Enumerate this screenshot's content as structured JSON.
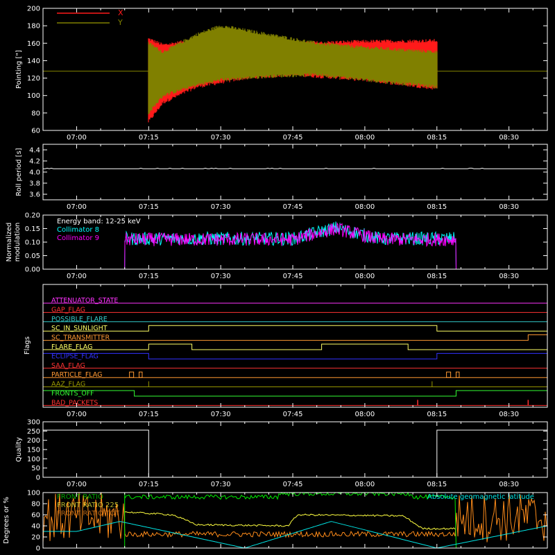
{
  "colors": {
    "background": "#000000",
    "axis": "#ffffff",
    "pointing_x": "#ff1a1a",
    "pointing_y": "#808000",
    "collimator_8": "#00ffff",
    "collimator_9": "#ff00ff",
    "green": "#00ee00",
    "yellow": "#ffff40",
    "orange": "#ff8c1a",
    "cyan": "#00e5e5"
  },
  "time_ticks": [
    "07:00",
    "07:15",
    "07:30",
    "07:45",
    "08:00",
    "08:15",
    "08:30"
  ],
  "chart_data": [
    {
      "type": "line",
      "panel": "pointing",
      "ylabel": "Pointing [\"]",
      "ylim": [
        60,
        200
      ],
      "yticks": [
        "60",
        "80",
        "100",
        "120",
        "140",
        "160",
        "180",
        "200"
      ],
      "legend": [
        "X",
        "Y"
      ],
      "legend_placement": "top-left",
      "baseline": 128,
      "data_window": [
        "07:15",
        "08:15"
      ],
      "series": [
        {
          "name": "X",
          "envelope_times": [
            "07:15",
            "07:18",
            "07:25",
            "07:35",
            "07:45",
            "08:00",
            "08:15"
          ],
          "upper": [
            165,
            158,
            164,
            163,
            160,
            162,
            163
          ],
          "lower": [
            70,
            92,
            110,
            120,
            124,
            118,
            108
          ]
        },
        {
          "name": "Y",
          "envelope_times": [
            "07:15",
            "07:18",
            "07:25",
            "07:30",
            "07:40",
            "07:50",
            "08:00",
            "08:15"
          ],
          "upper": [
            160,
            150,
            170,
            180,
            170,
            160,
            155,
            150
          ],
          "lower": [
            80,
            100,
            112,
            118,
            122,
            124,
            118,
            110
          ]
        }
      ]
    },
    {
      "type": "line",
      "panel": "roll",
      "ylabel": "Roll period [s]",
      "ylim": [
        3.5,
        4.5
      ],
      "yticks": [
        "3.6",
        "3.8",
        "4.0",
        "4.2",
        "4.4"
      ],
      "series": [
        {
          "values": [
            4.06,
            4.06,
            4.06,
            4.06,
            4.06,
            4.06,
            4.06
          ]
        }
      ]
    },
    {
      "type": "line",
      "panel": "modulation",
      "ylabel": "Normalized modulation",
      "ylim": [
        0,
        0.2
      ],
      "yticks": [
        "0.00",
        "0.05",
        "0.10",
        "0.15",
        "0.20"
      ],
      "annotation": "Energy band: 12-25 keV",
      "legend": [
        "Collimator 8",
        "Collimator 9"
      ],
      "start_time": "07:10",
      "end_time": "08:19",
      "mean": 0.11,
      "bump": {
        "from": "07:50",
        "to": "07:58",
        "peak": 0.15
      }
    },
    {
      "type": "line",
      "panel": "flags",
      "ylabel": "Flags",
      "flags": [
        {
          "label": "ATTENUATOR_STATE",
          "color": "#ff33ff",
          "changes": []
        },
        {
          "label": "GAP_FLAG",
          "color": "#ff3333",
          "changes": []
        },
        {
          "label": "POSSIBLE_FLARE",
          "color": "#33cccc",
          "changes": []
        },
        {
          "label": "SC_IN_SUNLIGHT",
          "color": "#ffff66",
          "changes": [
            [
              "07:15",
              1
            ],
            [
              "08:15",
              0
            ]
          ]
        },
        {
          "label": "SC_TRANSMITTER",
          "color": "#ff9933",
          "changes": [
            [
              "08:34",
              1
            ]
          ]
        },
        {
          "label": "FLARE_FLAG",
          "color": "#ffff66",
          "changes": [
            [
              "07:15",
              1
            ],
            [
              "07:24",
              0
            ],
            [
              "07:51",
              1
            ],
            [
              "08:09",
              0
            ]
          ]
        },
        {
          "label": "ECLIPSE_FLAG",
          "color": "#3333ff",
          "initial": 1,
          "changes": [
            [
              "07:15",
              0
            ],
            [
              "08:15",
              1
            ]
          ]
        },
        {
          "label": "SAA_FLAG",
          "color": "#ff3333",
          "changes": []
        },
        {
          "label": "PARTICLE_FLAG",
          "color": "#ff9933",
          "changes": []
        },
        {
          "label": "AAZ_FLAG",
          "color": "#999900",
          "changes": []
        },
        {
          "label": "FRONTS_OFF",
          "color": "#33ff33",
          "initial": 1,
          "changes": [
            [
              "07:12",
              0
            ],
            [
              "08:19",
              1
            ]
          ]
        },
        {
          "label": "BAD_PACKETS",
          "color": "#ff3333",
          "changes": []
        }
      ]
    },
    {
      "type": "line",
      "panel": "quality",
      "ylabel": "Quality",
      "ylim": [
        0,
        300
      ],
      "yticks": [
        "0",
        "50",
        "100",
        "150",
        "200",
        "250",
        "300"
      ],
      "segments": [
        {
          "from": "07:00",
          "to": "07:15",
          "value": 255
        },
        {
          "from": "07:15",
          "to": "08:15",
          "value": 0
        },
        {
          "from": "08:15",
          "to": "08:38",
          "value": 255
        }
      ]
    },
    {
      "type": "line",
      "panel": "rates",
      "ylabel": "Degrees or %",
      "ylim": [
        0,
        100
      ],
      "yticks": [
        "0",
        "20",
        "40",
        "60",
        "80",
        "100"
      ],
      "legend_right": "Absolute geomagnetic latitude",
      "legend_left": [
        "FRONT RATIO",
        "FRONT RATIO 225",
        "FRONT RATIO TOT"
      ],
      "series": [
        {
          "name": "Absolute geomagnetic latitude",
          "times": [
            "07:00",
            "07:09",
            "07:35",
            "07:53",
            "08:15",
            "08:38"
          ],
          "values": [
            30,
            48,
            0,
            48,
            0,
            40
          ]
        }
      ]
    }
  ]
}
